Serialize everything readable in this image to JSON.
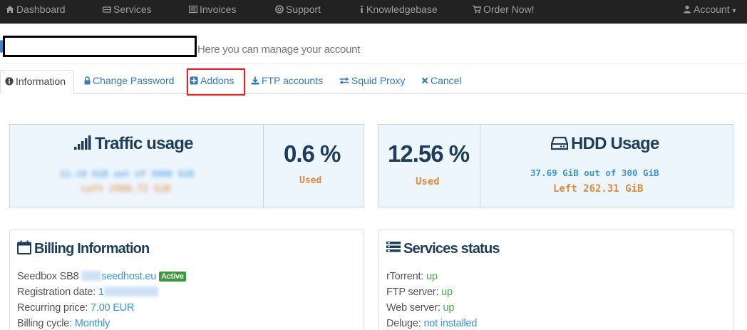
{
  "colors": {
    "navbar_bg": "#222222",
    "navbar_text": "#9d9d9d",
    "link_blue": "#337ab7",
    "title_navy": "#1c3e5a",
    "accent_orange": "#e08a3c",
    "mono_blue": "#3a93d6",
    "status_green": "#4ca84c",
    "highlight_red": "#d9262c",
    "stat_panel_bg": "#eef6fd"
  },
  "navbar": {
    "items": [
      {
        "label": "Dashboard",
        "icon": "home-icon"
      },
      {
        "label": "Services",
        "icon": "server-icon"
      },
      {
        "label": "Invoices",
        "icon": "list-icon"
      },
      {
        "label": "Support",
        "icon": "lifebuoy-icon"
      },
      {
        "label": "Knowledgebase",
        "icon": "info-icon"
      },
      {
        "label": "Order Now!",
        "icon": "cart-icon"
      }
    ],
    "account": {
      "label": "Account",
      "icon": "user-icon",
      "caret": "▾"
    }
  },
  "header": {
    "subtitle": "Here you can manage your account"
  },
  "tabs": [
    {
      "label": "Information",
      "icon": "info-circle-icon",
      "active": true
    },
    {
      "label": "Change Password",
      "icon": "lock-icon"
    },
    {
      "label": "Addons",
      "icon": "plus-square-icon",
      "highlighted": true
    },
    {
      "label": "FTP accounts",
      "icon": "download-icon"
    },
    {
      "label": "Squid Proxy",
      "icon": "exchange-icon"
    },
    {
      "label": "Cancel",
      "icon": "times-icon"
    }
  ],
  "traffic": {
    "title": "Traffic usage",
    "icon": "signal-icon",
    "line1": "11.18 GiB out of 3000 GiB",
    "line2": "Left 2988.72 GiB",
    "percent": "0.6 %",
    "used_label": "Used"
  },
  "hdd": {
    "title": "HDD Usage",
    "icon": "hdd-icon",
    "percent": "12.56 %",
    "used_label": "Used",
    "line1": "37.69 GiB out of 300 GiB",
    "line2": "Left 262.31 GiB"
  },
  "billing": {
    "title": "Billing Information",
    "icon": "calendar-icon",
    "product_prefix": "Seedbox SB8",
    "product_domain": "seedhost.eu",
    "status_badge": "Active",
    "registration_label": "Registration date:",
    "registration_value": "1",
    "recurring_label": "Recurring price:",
    "recurring_value": "7.00 EUR",
    "cycle_label": "Billing cycle:",
    "cycle_value": "Monthly"
  },
  "services": {
    "title": "Services status",
    "icon": "tasks-icon",
    "items": [
      {
        "label": "rTorrent:",
        "value": "up"
      },
      {
        "label": "FTP server:",
        "value": "up"
      },
      {
        "label": "Web server:",
        "value": "up"
      },
      {
        "label": "Deluge:",
        "value": "not installed"
      }
    ]
  }
}
